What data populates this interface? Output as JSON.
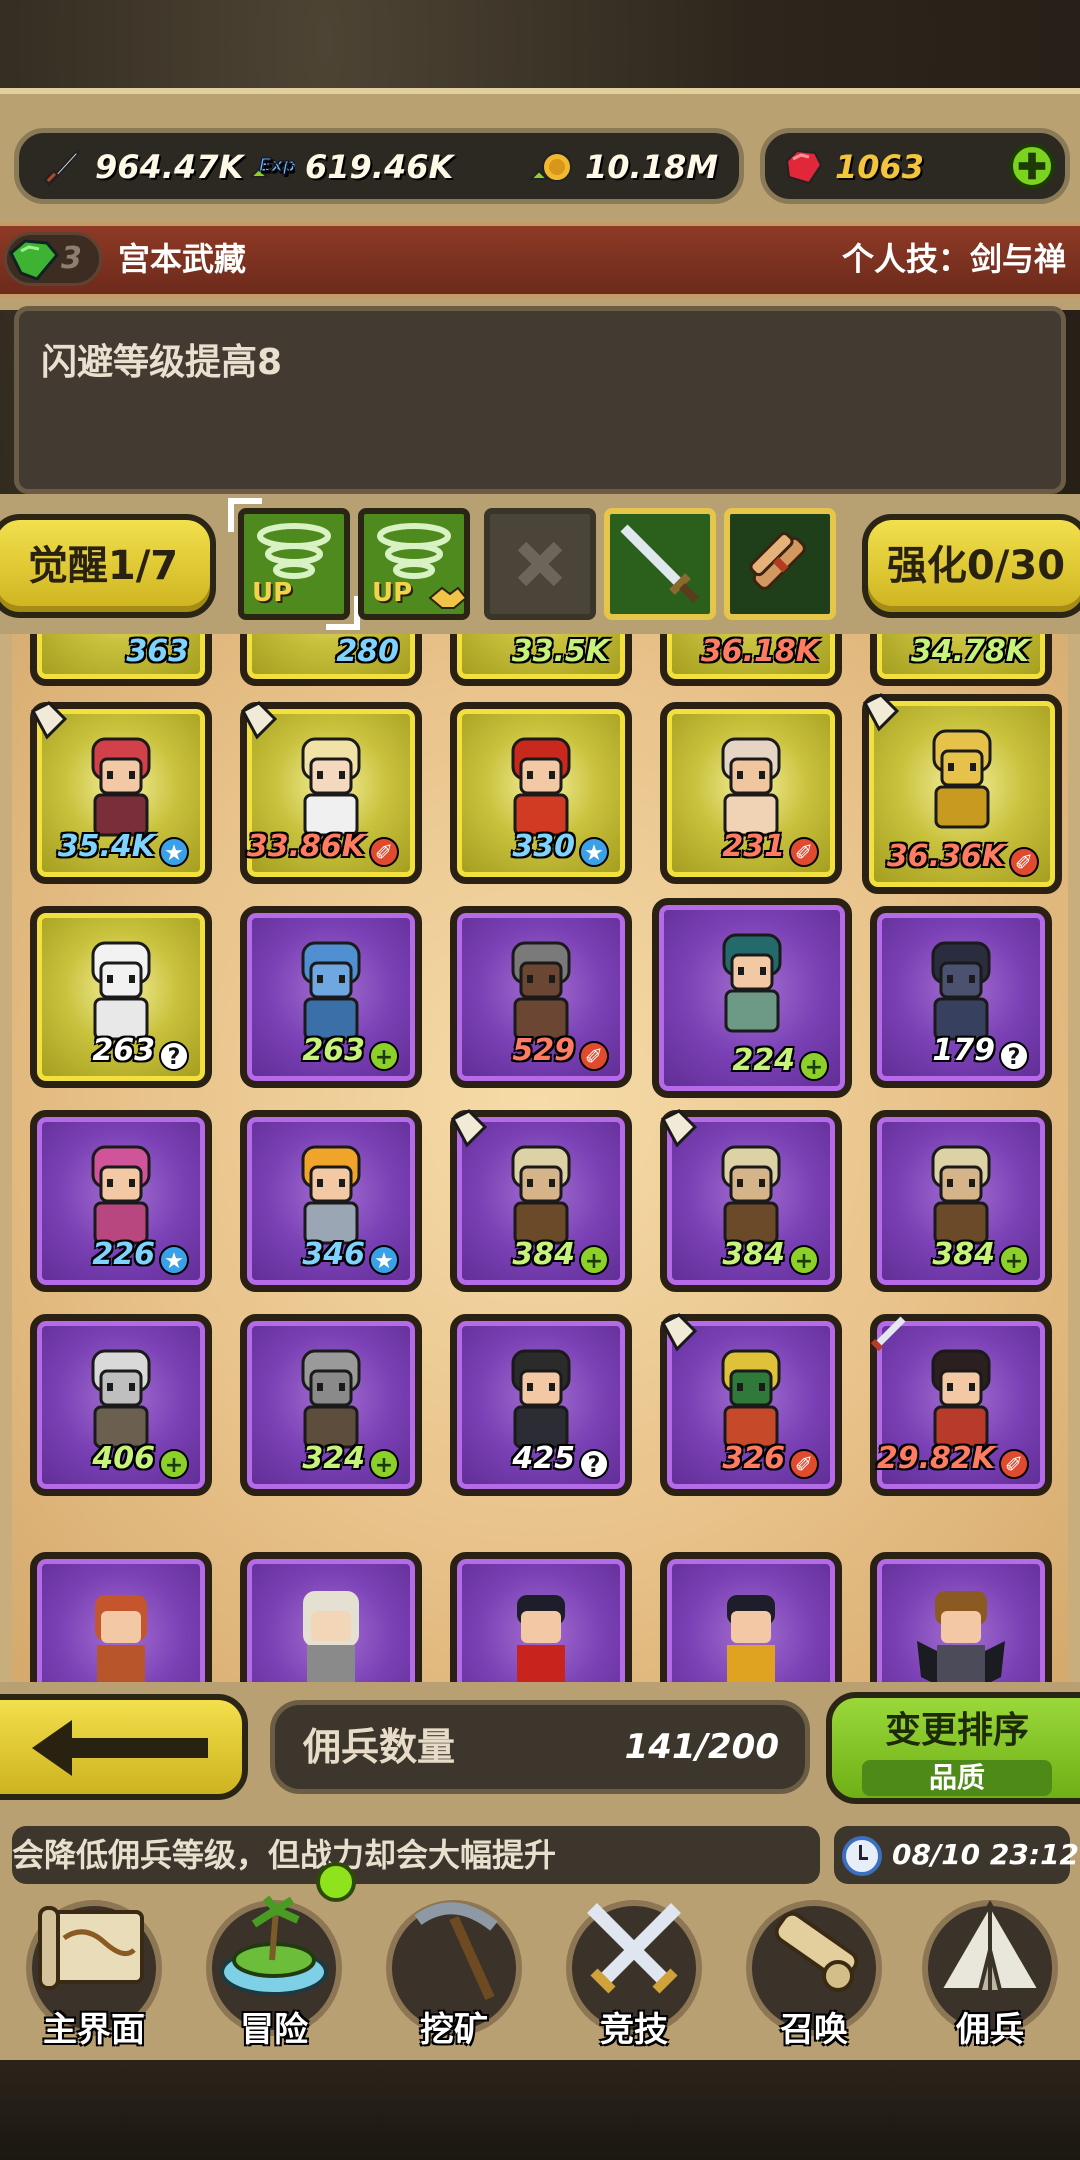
{
  "resources": {
    "attack": "964.47K",
    "exp": "619.46K",
    "gold": "10.18M",
    "gems": "1063",
    "exp_icon_text": "Exp"
  },
  "hero": {
    "star_level": "3",
    "name": "宫本武藏",
    "skill": "个人技：剑与禅",
    "description": "闪避等级提高8"
  },
  "actions": {
    "awaken": "觉醒1/7",
    "enhance": "强化0/30",
    "up_tag": "UP"
  },
  "grid_partial_top": [
    "363",
    "280",
    "33.5K",
    "36.18K",
    "34.78K"
  ],
  "mercenaries": [
    {
      "power": "35.4K",
      "badge": "blue",
      "rarity": "gold"
    },
    {
      "power": "33.86K",
      "badge": "red",
      "rarity": "gold"
    },
    {
      "power": "330",
      "badge": "blue",
      "rarity": "gold"
    },
    {
      "power": "231",
      "badge": "red",
      "rarity": "gold"
    },
    {
      "power": "36.36K",
      "badge": "red",
      "rarity": "gold"
    },
    {
      "power": "263",
      "badge": "white",
      "rarity": "gold"
    },
    {
      "power": "263",
      "badge": "green",
      "rarity": "purple"
    },
    {
      "power": "529",
      "badge": "red",
      "rarity": "purple"
    },
    {
      "power": "224",
      "badge": "green",
      "rarity": "purple"
    },
    {
      "power": "179",
      "badge": "white",
      "rarity": "purple"
    },
    {
      "power": "226",
      "badge": "blue",
      "rarity": "purple"
    },
    {
      "power": "346",
      "badge": "blue",
      "rarity": "purple"
    },
    {
      "power": "384",
      "badge": "green",
      "rarity": "purple"
    },
    {
      "power": "384",
      "badge": "green",
      "rarity": "purple"
    },
    {
      "power": "384",
      "badge": "green",
      "rarity": "purple"
    },
    {
      "power": "406",
      "badge": "green",
      "rarity": "purple"
    },
    {
      "power": "324",
      "badge": "green",
      "rarity": "purple"
    },
    {
      "power": "425",
      "badge": "white",
      "rarity": "purple"
    },
    {
      "power": "326",
      "badge": "red",
      "rarity": "purple"
    },
    {
      "power": "29.82K",
      "badge": "red",
      "rarity": "purple"
    }
  ],
  "footer": {
    "back_label": "",
    "count_label": "佣兵数量",
    "count_value": "141/200",
    "sort_label": "变更排序",
    "sort_mode": "品质",
    "ticker": "会降低佣兵等级，但战力却会大幅提升",
    "clock": "08/10 23:12"
  },
  "nav": [
    {
      "label": "主界面",
      "icon": "map-scroll-icon"
    },
    {
      "label": "冒险",
      "icon": "island-icon"
    },
    {
      "label": "挖矿",
      "icon": "pickaxe-icon"
    },
    {
      "label": "竞技",
      "icon": "crossed-swords-icon"
    },
    {
      "label": "召唤",
      "icon": "summon-scroll-icon"
    },
    {
      "label": "佣兵",
      "icon": "tent-icon"
    }
  ],
  "colors": {
    "gold_card": "#c9c23d",
    "purple_card": "#7a40b5",
    "yellow_button": "#e3cf39",
    "green_button": "#8ccf2c",
    "banner": "#7e3220"
  }
}
